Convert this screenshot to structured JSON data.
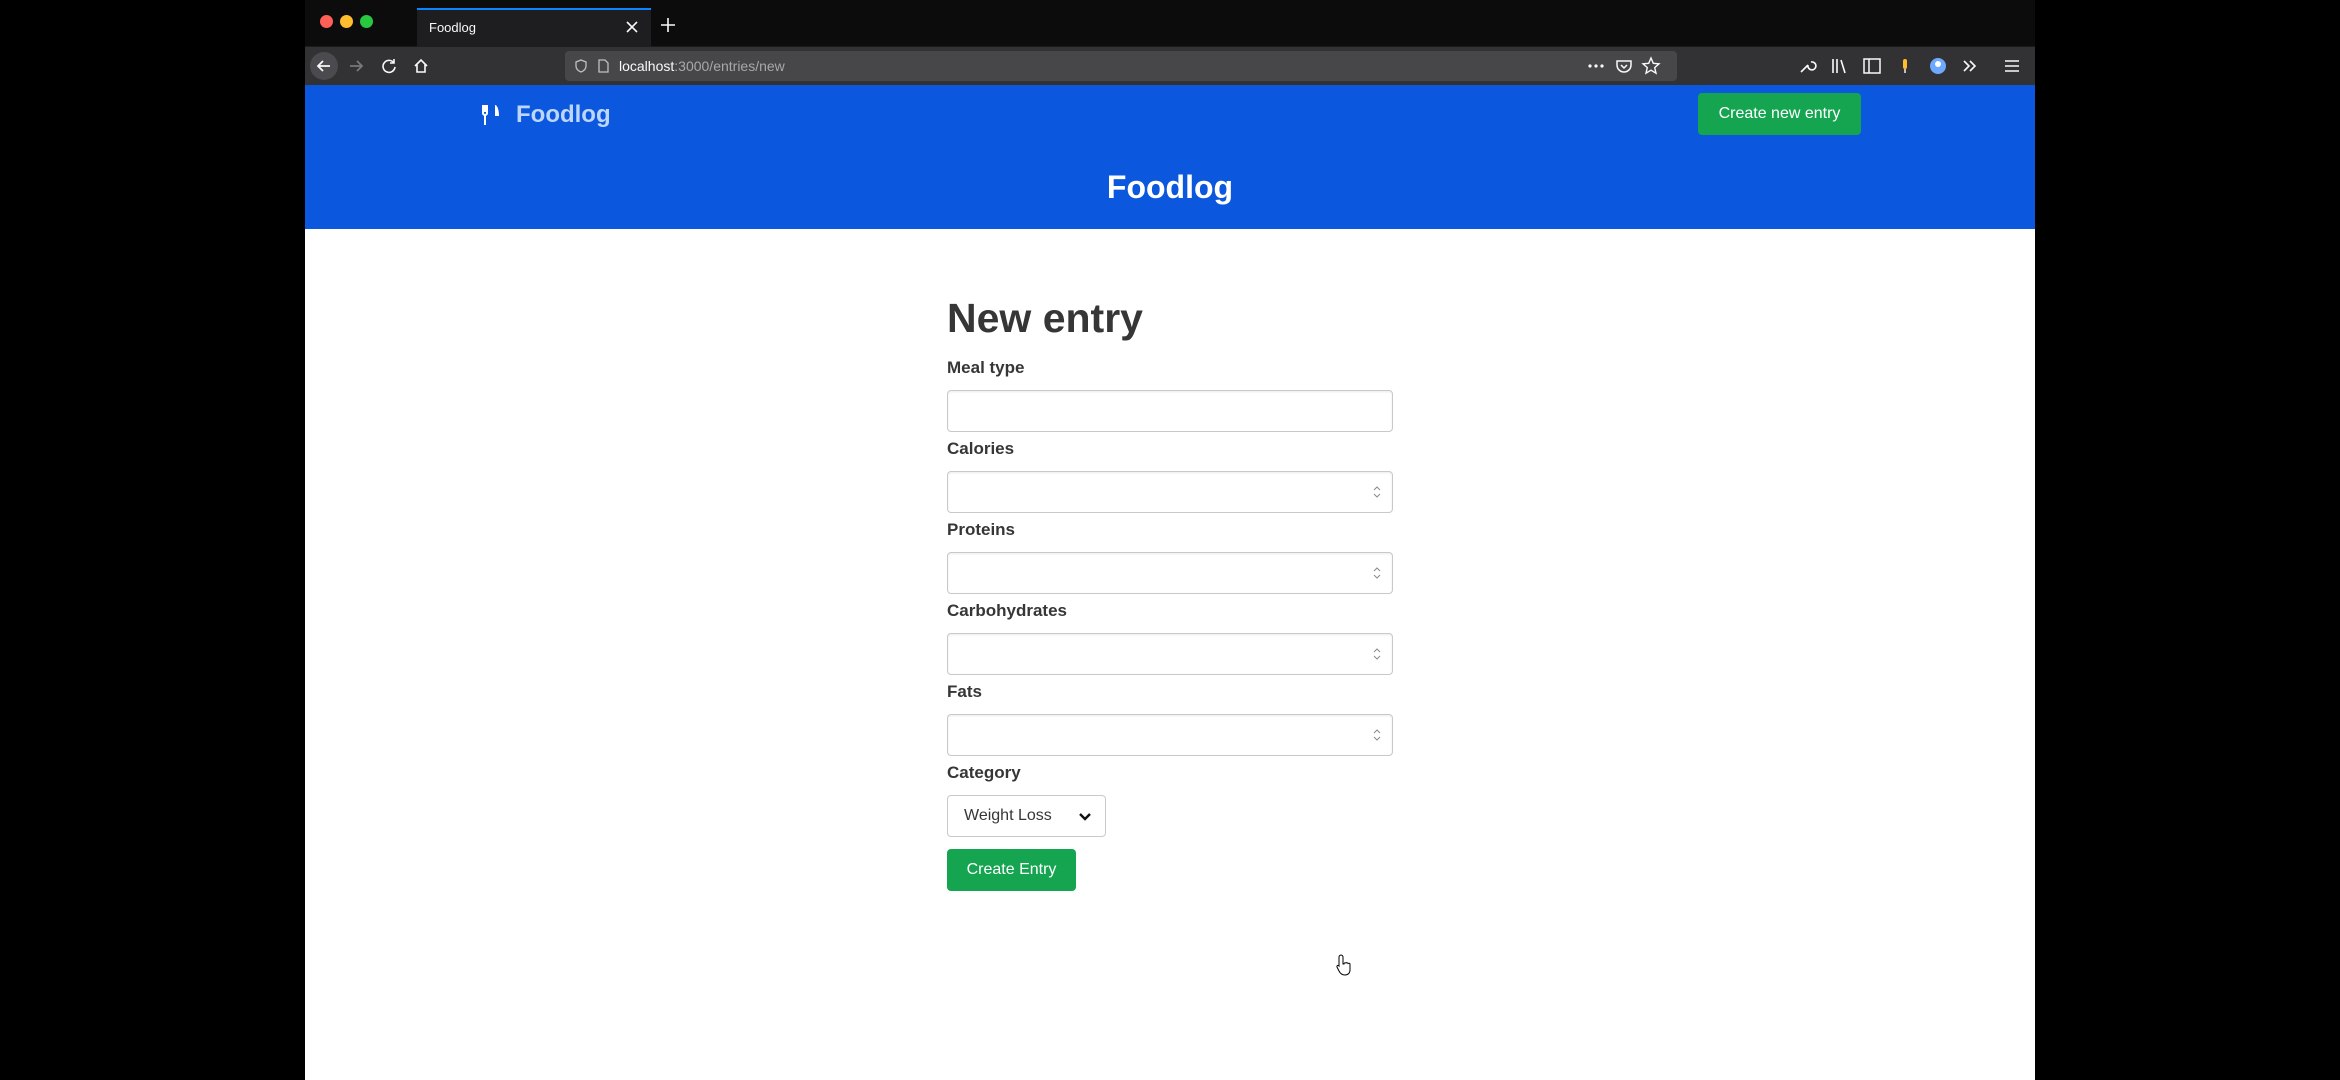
{
  "browser": {
    "tab_title": "Foodlog",
    "url_host": "localhost",
    "url_path": ":3000/entries/new"
  },
  "site": {
    "brand": "Foodlog",
    "create_new_label": "Create new entry",
    "header_title": "Foodlog"
  },
  "form": {
    "title": "New entry",
    "fields": [
      {
        "label": "Meal type",
        "value": "",
        "type": "text"
      },
      {
        "label": "Calories",
        "value": "",
        "type": "number"
      },
      {
        "label": "Proteins",
        "value": "",
        "type": "number"
      },
      {
        "label": "Carbohydrates",
        "value": "",
        "type": "number"
      },
      {
        "label": "Fats",
        "value": "",
        "type": "number"
      }
    ],
    "category_label": "Category",
    "category_value": "Weight Loss",
    "submit_label": "Create Entry"
  },
  "colors": {
    "header_bg": "#0b57de",
    "button_green": "#15a551",
    "brand_text": "#bcd6ff"
  },
  "icons": [
    "fork-knife-icon",
    "shield-icon",
    "page-icon",
    "back-arrow-icon",
    "forward-arrow-icon",
    "reload-icon",
    "home-icon",
    "star-icon",
    "pocket-icon",
    "wrench-icon",
    "library-icon",
    "sidebar-icon",
    "chevron-down-icon",
    "pointer-cursor-icon"
  ]
}
